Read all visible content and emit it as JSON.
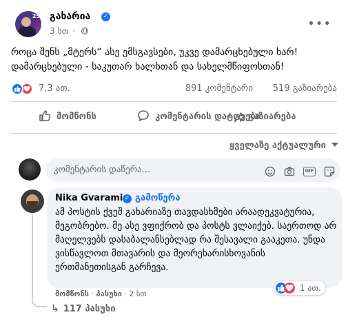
{
  "post": {
    "page_name": "გახარია",
    "time": "3 სთ",
    "text": "როცა შენს „მტერს“ ასე ემსგავსები, უკვე დამარცხებული ხარ! დამარცხებული - საკუთარ ხალხთან და სახელმწიფოსთან!",
    "avatar_badge": "25"
  },
  "stats": {
    "reactions": "7,3 ათ.",
    "comments": "891 კომენტარი",
    "shares": "519 გაზიარება"
  },
  "actions": {
    "like": "მომწონს",
    "comment": "კომენტარის დატოვება",
    "share": "გაზიარება"
  },
  "sort": {
    "label": "ყველაზე აქტუალური"
  },
  "composer": {
    "placeholder": "კომენტარის დაწერა..."
  },
  "comment": {
    "author": "Nika Gvaramia",
    "follow": "გამოწერა",
    "text": "ამ პოსტის ქვეშ გახარიაზე თავდასხმები არაადეკვატურია, მეგობრებო. მე ასე ვფიქრობ და პოსტს ვლაიქებ. საერთოდ არ მაღელვებს დასაბალანსებლად რა შესავალი გააკეთა. უნდა ვისწავლოთ მთავარის და მეორეხარისხოვანის ერთმანეთისგან გარჩევა.",
    "reactions": "1 ათ.",
    "like_label": "მომწონს",
    "reply_label": "პასუხი",
    "time": "2 სთ",
    "replies": "117 პასუხი"
  },
  "colors": {
    "accent": "#1877f2",
    "love": "#f33e58",
    "muted": "#65676b",
    "bubble": "#f0f2f5"
  },
  "icons": [
    "globe-icon",
    "more-icon",
    "like-icon",
    "love-icon",
    "comment-icon",
    "share-icon",
    "chevron-down-icon",
    "emoji-icon",
    "camera-icon",
    "gif-icon",
    "sticker-icon",
    "verified-icon",
    "reply-arrow-icon"
  ]
}
